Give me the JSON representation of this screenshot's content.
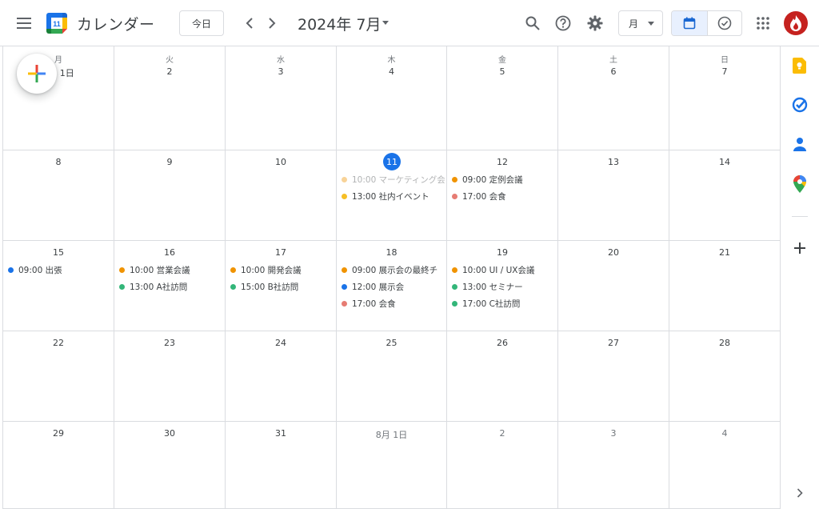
{
  "header": {
    "app_title": "カレンダー",
    "logo_day": "11",
    "today_label": "今日",
    "month_title": "2024年 7月",
    "view_select": "月"
  },
  "weekdays": [
    "月",
    "火",
    "水",
    "木",
    "金",
    "土",
    "日"
  ],
  "weeks": [
    [
      {
        "label": "7月 1日",
        "other": false,
        "events": []
      },
      {
        "label": "2",
        "other": false,
        "events": []
      },
      {
        "label": "3",
        "other": false,
        "events": []
      },
      {
        "label": "4",
        "other": false,
        "events": []
      },
      {
        "label": "5",
        "other": false,
        "events": []
      },
      {
        "label": "6",
        "other": false,
        "events": []
      },
      {
        "label": "7",
        "other": false,
        "events": []
      }
    ],
    [
      {
        "label": "8",
        "other": false,
        "events": []
      },
      {
        "label": "9",
        "other": false,
        "events": []
      },
      {
        "label": "10",
        "other": false,
        "events": []
      },
      {
        "label": "11",
        "other": false,
        "today": true,
        "events": [
          {
            "text": "10:00 マーケティング会",
            "color": "#f09300",
            "faded": true
          },
          {
            "text": "13:00 社内イベント",
            "color": "#f6bf26"
          }
        ]
      },
      {
        "label": "12",
        "other": false,
        "events": [
          {
            "text": "09:00 定例会議",
            "color": "#f09300"
          },
          {
            "text": "17:00 会食",
            "color": "#e67c73"
          }
        ]
      },
      {
        "label": "13",
        "other": false,
        "events": []
      },
      {
        "label": "14",
        "other": false,
        "events": []
      }
    ],
    [
      {
        "label": "15",
        "other": false,
        "events": [
          {
            "text": "09:00 出張",
            "color": "#1a73e8"
          }
        ]
      },
      {
        "label": "16",
        "other": false,
        "events": [
          {
            "text": "10:00 営業会議",
            "color": "#f09300"
          },
          {
            "text": "13:00 A社訪問",
            "color": "#33b679"
          }
        ]
      },
      {
        "label": "17",
        "other": false,
        "events": [
          {
            "text": "10:00 開発会議",
            "color": "#f09300"
          },
          {
            "text": "15:00 B社訪問",
            "color": "#33b679"
          }
        ]
      },
      {
        "label": "18",
        "other": false,
        "events": [
          {
            "text": "09:00 展示会の最終チ",
            "color": "#f09300"
          },
          {
            "text": "12:00 展示会",
            "color": "#1a73e8"
          },
          {
            "text": "17:00 会食",
            "color": "#e67c73"
          }
        ]
      },
      {
        "label": "19",
        "other": false,
        "events": [
          {
            "text": "10:00 UI / UX会議",
            "color": "#f09300"
          },
          {
            "text": "13:00 セミナー",
            "color": "#33b679"
          },
          {
            "text": "17:00 C社訪問",
            "color": "#33b679"
          }
        ]
      },
      {
        "label": "20",
        "other": false,
        "events": []
      },
      {
        "label": "21",
        "other": false,
        "events": []
      }
    ],
    [
      {
        "label": "22",
        "other": false,
        "events": []
      },
      {
        "label": "23",
        "other": false,
        "events": []
      },
      {
        "label": "24",
        "other": false,
        "events": []
      },
      {
        "label": "25",
        "other": false,
        "events": []
      },
      {
        "label": "26",
        "other": false,
        "events": []
      },
      {
        "label": "27",
        "other": false,
        "events": []
      },
      {
        "label": "28",
        "other": false,
        "events": []
      }
    ],
    [
      {
        "label": "29",
        "other": false,
        "events": []
      },
      {
        "label": "30",
        "other": false,
        "events": []
      },
      {
        "label": "31",
        "other": false,
        "events": []
      },
      {
        "label": "8月 1日",
        "other": true,
        "events": []
      },
      {
        "label": "2",
        "other": true,
        "events": []
      },
      {
        "label": "3",
        "other": true,
        "events": []
      },
      {
        "label": "4",
        "other": true,
        "events": []
      }
    ]
  ],
  "sidepanel": {
    "icons": [
      "keep-icon",
      "tasks-icon",
      "contacts-icon",
      "maps-icon"
    ],
    "add_icon": "plus-icon",
    "expand_icon": "chevron-right-icon"
  },
  "colors": {
    "accent": "#1a73e8",
    "orange": "#f09300",
    "yellow": "#f6bf26",
    "green": "#33b679",
    "red": "#e67c73",
    "avatar": "#c5221f"
  }
}
